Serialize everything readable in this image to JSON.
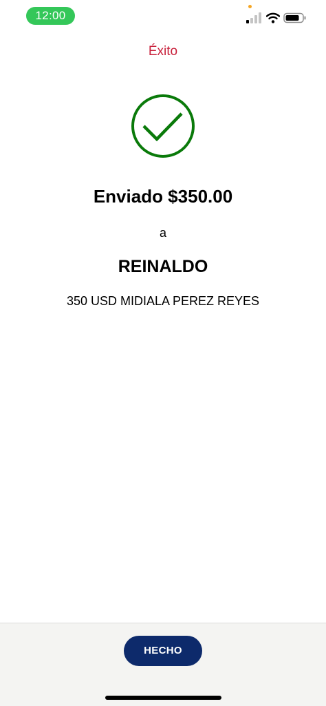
{
  "status_bar": {
    "time": "12:00",
    "icons": [
      "signal-icon",
      "wifi-icon",
      "battery-icon"
    ],
    "time_pill_color": "#34c759"
  },
  "header": {
    "title": "Éxito"
  },
  "result": {
    "icon": "check-circle-icon",
    "icon_color": "#0a7a0a",
    "amount_text": "Enviado $350.00",
    "to_label": "a",
    "recipient": "REINALDO",
    "note": "350 USD MIDIALA PEREZ REYES"
  },
  "footer": {
    "done_label": "HECHO",
    "button_color": "#0d2a6b"
  },
  "colors": {
    "title": "#c8203b"
  }
}
